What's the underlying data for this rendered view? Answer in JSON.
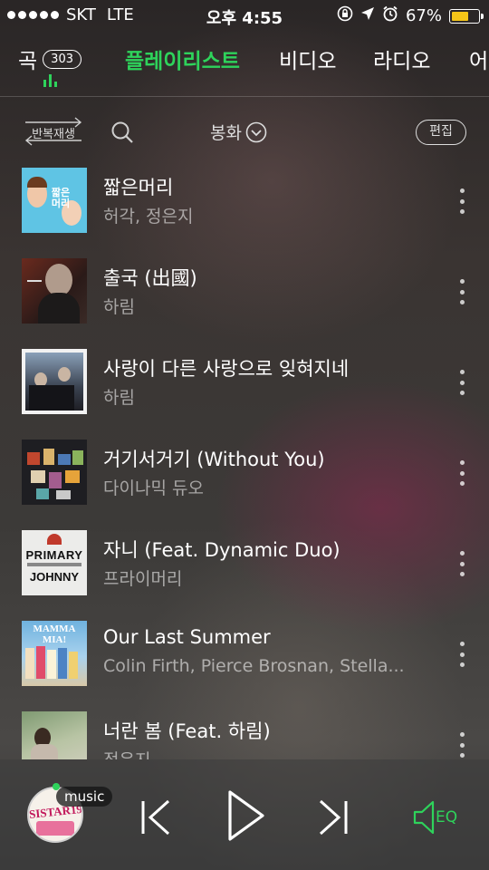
{
  "status_bar": {
    "carrier": "SKT",
    "network": "LTE",
    "time": "오후 4:55",
    "battery_percent": "67%",
    "battery_level": 0.67,
    "battery_color": "#f5c518"
  },
  "tabs": [
    {
      "label": "곡",
      "count": "303"
    },
    {
      "label": "플레이리스트",
      "active": true
    },
    {
      "label": "비디오"
    },
    {
      "label": "라디오"
    },
    {
      "label": "어"
    }
  ],
  "accent_color": "#2ed35b",
  "toolbar": {
    "repeat_label": "반복재생",
    "search_icon": "search-icon",
    "sort_label": "봉화",
    "edit_label": "편집"
  },
  "songs": [
    {
      "title": "짧은머리",
      "artist": "허각, 정은지"
    },
    {
      "title": "출국 (出國)",
      "artist": "하림"
    },
    {
      "title": "사랑이 다른 사랑으로 잊혀지네",
      "artist": "하림"
    },
    {
      "title": "거기서거기 (Without You)",
      "artist": "다이나믹 듀오"
    },
    {
      "title": "자니 (Feat. Dynamic Duo)",
      "artist": "프라이머리"
    },
    {
      "title": "Our Last Summer",
      "artist": "Colin Firth, Pierce Brosnan, Stella..."
    },
    {
      "title": "너란 봄 (Feat. 하림)",
      "artist": "정은지"
    }
  ],
  "album_art_text": {
    "song1": "짧은 머리",
    "song5_line1": "PRIMARY",
    "song5_line2": "JOHNNY",
    "song6": "MAMMA MIA!"
  },
  "player": {
    "tag": "music",
    "eq_label": "EQ",
    "art_text": "SISTAR19"
  }
}
